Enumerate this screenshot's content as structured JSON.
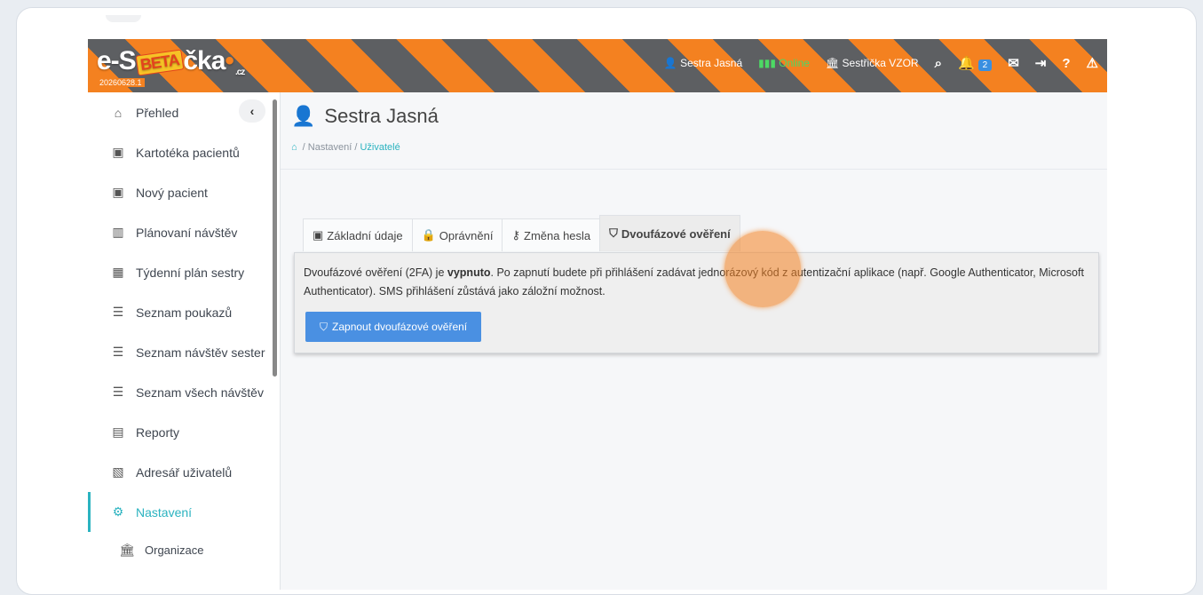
{
  "header": {
    "logo_prefix": "e-S",
    "logo_beta": "BETA",
    "logo_suffix": "čka",
    "logo_tld": ".cz",
    "build": "20260628.1",
    "user": "Sestra Jasná",
    "status": "Online",
    "org": "Sestřička VZOR",
    "notifications": "2",
    "icons": [
      "user-icon",
      "signal-icon",
      "bank-icon",
      "search-icon",
      "bell-icon",
      "mail-icon",
      "logout-icon",
      "help-icon",
      "warning-icon"
    ]
  },
  "sidebar": {
    "items": [
      {
        "label": "Přehled",
        "icon": "home-icon"
      },
      {
        "label": "Kartotéka pacientů",
        "icon": "id-card-icon"
      },
      {
        "label": "Nový pacient",
        "icon": "id-card-icon"
      },
      {
        "label": "Plánovaní návštěv",
        "icon": "map-icon"
      },
      {
        "label": "Týdenní plán sestry",
        "icon": "calendar-icon"
      },
      {
        "label": "Seznam poukazů",
        "icon": "list-icon"
      },
      {
        "label": "Seznam návštěv sester",
        "icon": "list-icon"
      },
      {
        "label": "Seznam všech návštěv",
        "icon": "list-icon"
      },
      {
        "label": "Reporty",
        "icon": "chart-icon"
      },
      {
        "label": "Adresář uživatelů",
        "icon": "address-book-icon"
      },
      {
        "label": "Nastavení",
        "icon": "cogs-icon"
      },
      {
        "label": "Organizace",
        "icon": "bank-icon"
      }
    ]
  },
  "page": {
    "title": "Sestra Jasná",
    "breadcrumb": [
      "Nastavení",
      "Uživatelé"
    ]
  },
  "tabs": [
    {
      "label": "Základní údaje",
      "icon": "id-card-icon"
    },
    {
      "label": "Oprávnění",
      "icon": "lock-icon"
    },
    {
      "label": "Změna hesla",
      "icon": "key-icon"
    },
    {
      "label": "Dvoufázové ověření",
      "icon": "shield-icon"
    }
  ],
  "panel": {
    "text_before": "Dvoufázové ověření (2FA) je ",
    "text_bold": "vypnuto",
    "text_after": ". Po zapnutí budete při přihlášení zadávat jednorázový kód z autentizační aplikace (např. Google Authenticator, Microsoft Authenticator). SMS přihlášení zůstává jako záložní možnost.",
    "button": "Zapnout dvoufázové ověření"
  },
  "colors": {
    "accent": "#2bb3c0",
    "header_orange": "#f48120",
    "header_gray": "#5d5f62",
    "button_blue": "#4a90e2",
    "online_green": "#4cd964"
  }
}
